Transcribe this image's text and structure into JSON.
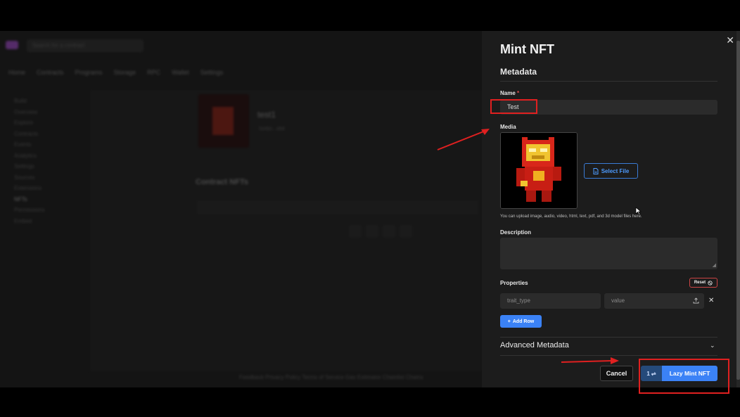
{
  "background": {
    "search_placeholder": "Search for a contract",
    "nav": [
      "Home",
      "Contracts",
      "Programs",
      "Storage",
      "RPC",
      "Wallet",
      "Settings"
    ],
    "sidebar": [
      "Build",
      "Overview",
      "Explore",
      "Contracts",
      "Events",
      "Analytics",
      "Settings",
      "Sources",
      "Extensions",
      "NFTs",
      "Permissions",
      "Embed"
    ],
    "contract_title": "test1",
    "contract_sub": "0xAbc...eb6",
    "section_title": "Contract NFTs",
    "footer": "Feedback  Privacy Policy  Terms of Service  Gas Estimator  Chainlist  Chains"
  },
  "drawer": {
    "title": "Mint NFT",
    "section": "Metadata",
    "name_label": "Name",
    "name_required": "*",
    "name_value": "Test",
    "media_label": "Media",
    "select_file": "Select File",
    "media_hint": "You can upload image, audio, video, html, text, pdf, and 3d model files here.",
    "description_label": "Description",
    "properties_label": "Properties",
    "reset_label": "Reset",
    "trait_placeholder": "trait_type",
    "value_placeholder": "value",
    "add_row": "Add Row",
    "advanced": "Advanced Metadata",
    "cancel": "Cancel",
    "quantity": "1",
    "mint_label": "Lazy Mint NFT"
  },
  "colors": {
    "accent": "#3b82f6",
    "annotation": "#e02020",
    "drawer_bg": "#1c1c1c"
  },
  "icons": [
    "close-icon",
    "file-icon",
    "reset-icon",
    "upload-icon",
    "remove-icon",
    "plus-icon",
    "chevron-down-icon",
    "cursor-icon"
  ]
}
